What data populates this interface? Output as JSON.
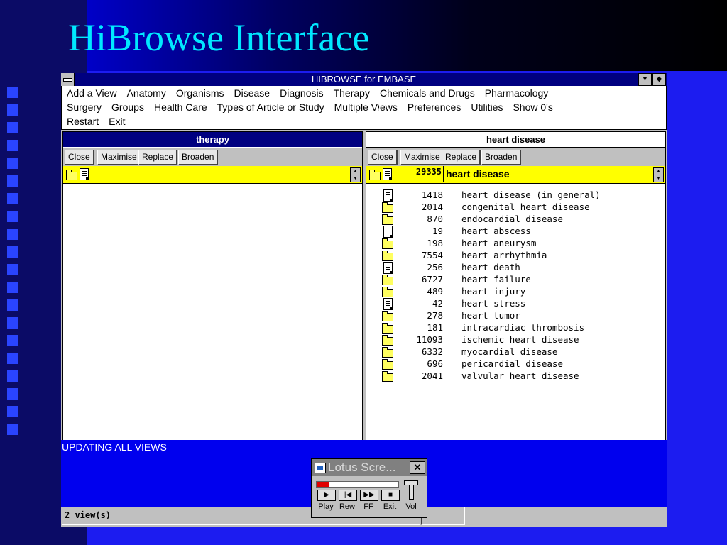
{
  "slide": {
    "title": "HiBrowse Interface"
  },
  "window": {
    "title": "HIBROWSE for EMBASE",
    "minimize_icon": "down-arrow-icon",
    "restore_icon": "updown-arrow-icon"
  },
  "menu": {
    "row1": [
      "Add a View",
      "Anatomy",
      "Organisms",
      "Disease",
      "Diagnosis",
      "Therapy",
      "Chemicals and Drugs",
      "Pharmacology"
    ],
    "row2": [
      "Surgery",
      "Groups",
      "Health Care",
      "Types of Article or Study",
      "Multiple Views",
      "Preferences",
      "Utilities",
      "Show 0's"
    ],
    "row3": [
      "Restart",
      "Exit"
    ]
  },
  "left_pane": {
    "title": "therapy",
    "buttons": [
      "Close",
      "Maximise",
      "Replace",
      "Broaden"
    ],
    "head_count": "",
    "head_label": ""
  },
  "right_pane": {
    "title": "heart disease",
    "buttons": [
      "Close",
      "Maximise",
      "Replace",
      "Broaden"
    ],
    "head_count": "29335",
    "head_label": "heart disease",
    "items": [
      {
        "icon": "doc-icon",
        "count": "1418",
        "label": "heart disease (in general)"
      },
      {
        "icon": "folder-icon",
        "count": "2014",
        "label": "congenital heart disease"
      },
      {
        "icon": "folder-icon",
        "count": "870",
        "label": "endocardial disease"
      },
      {
        "icon": "doc-icon",
        "count": "19",
        "label": "heart abscess"
      },
      {
        "icon": "folder-icon",
        "count": "198",
        "label": "heart aneurysm"
      },
      {
        "icon": "folder-icon",
        "count": "7554",
        "label": "heart arrhythmia"
      },
      {
        "icon": "doc-icon",
        "count": "256",
        "label": "heart death"
      },
      {
        "icon": "folder-icon",
        "count": "6727",
        "label": "heart failure"
      },
      {
        "icon": "folder-icon",
        "count": "489",
        "label": "heart injury"
      },
      {
        "icon": "doc-icon",
        "count": "42",
        "label": "heart stress"
      },
      {
        "icon": "folder-icon",
        "count": "278",
        "label": "heart tumor"
      },
      {
        "icon": "folder-icon",
        "count": "181",
        "label": "intracardiac thrombosis"
      },
      {
        "icon": "folder-icon",
        "count": "11093",
        "label": "ischemic heart disease"
      },
      {
        "icon": "folder-icon",
        "count": "6332",
        "label": "myocardial disease"
      },
      {
        "icon": "folder-icon",
        "count": "696",
        "label": "pericardial disease"
      },
      {
        "icon": "folder-icon",
        "count": "2041",
        "label": "valvular heart disease"
      }
    ]
  },
  "status": {
    "message": "UPDATING ALL VIEWS",
    "views": "2 view(s)"
  },
  "player": {
    "title": "Lotus Scre...",
    "progress": 0.15,
    "buttons": [
      {
        "label": "Play",
        "icon": "play-icon"
      },
      {
        "label": "Rew",
        "icon": "rewind-icon"
      },
      {
        "label": "FF",
        "icon": "fast-forward-icon"
      },
      {
        "label": "Exit",
        "icon": "grid-icon"
      }
    ],
    "volume_label": "Vol"
  }
}
